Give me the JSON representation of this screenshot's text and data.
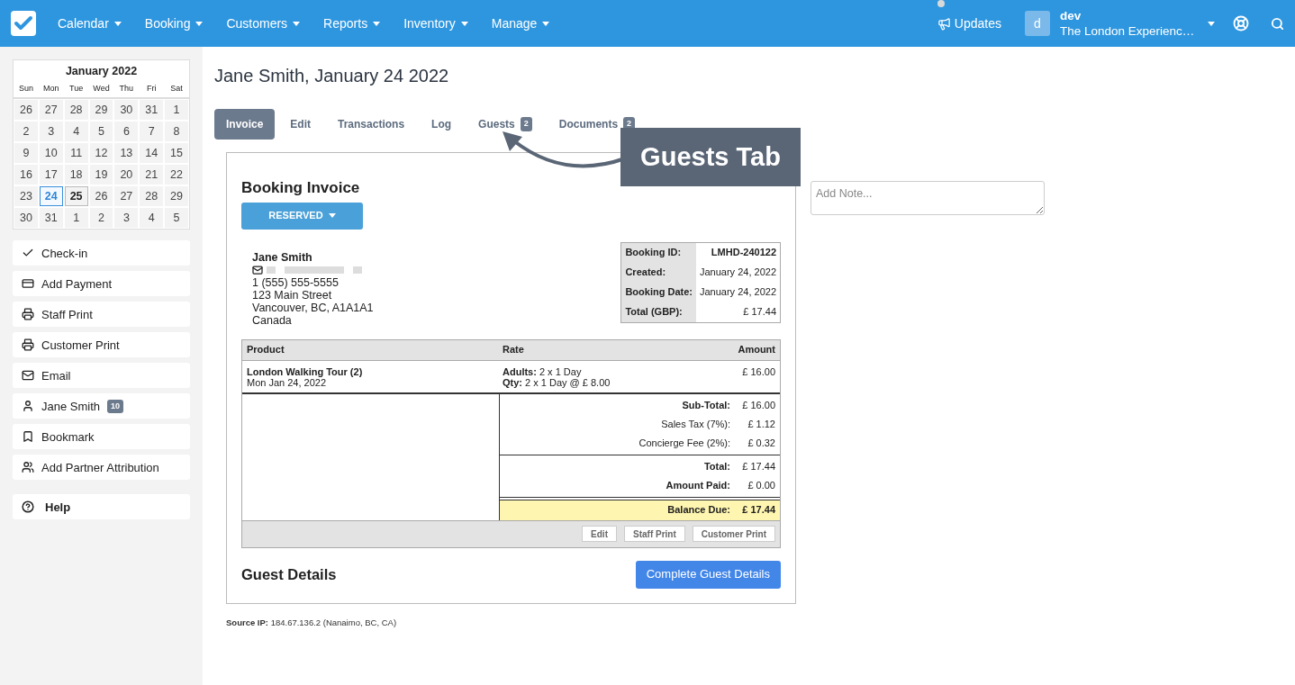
{
  "nav": {
    "menus": [
      {
        "label": "Calendar"
      },
      {
        "label": "Booking"
      },
      {
        "label": "Customers"
      },
      {
        "label": "Reports"
      },
      {
        "label": "Inventory"
      },
      {
        "label": "Manage"
      }
    ],
    "updates": {
      "label": "Updates",
      "unread": true
    },
    "user": {
      "initial": "d",
      "name": "dev",
      "company": "The London Experienc…"
    }
  },
  "calendar": {
    "title": "January 2022",
    "weekdays": [
      "Sun",
      "Mon",
      "Tue",
      "Wed",
      "Thu",
      "Fri",
      "Sat"
    ],
    "weeks": [
      [
        {
          "label": "26",
          "selected": false,
          "today": false
        },
        {
          "label": "27",
          "selected": false,
          "today": false
        },
        {
          "label": "28",
          "selected": false,
          "today": false
        },
        {
          "label": "29",
          "selected": false,
          "today": false
        },
        {
          "label": "30",
          "selected": false,
          "today": false
        },
        {
          "label": "31",
          "selected": false,
          "today": false
        },
        {
          "label": "1",
          "selected": false,
          "today": false
        }
      ],
      [
        {
          "label": "2",
          "selected": false,
          "today": false
        },
        {
          "label": "3",
          "selected": false,
          "today": false
        },
        {
          "label": "4",
          "selected": false,
          "today": false
        },
        {
          "label": "5",
          "selected": false,
          "today": false
        },
        {
          "label": "6",
          "selected": false,
          "today": false
        },
        {
          "label": "7",
          "selected": false,
          "today": false
        },
        {
          "label": "8",
          "selected": false,
          "today": false
        }
      ],
      [
        {
          "label": "9",
          "selected": false,
          "today": false
        },
        {
          "label": "10",
          "selected": false,
          "today": false
        },
        {
          "label": "11",
          "selected": false,
          "today": false
        },
        {
          "label": "12",
          "selected": false,
          "today": false
        },
        {
          "label": "13",
          "selected": false,
          "today": false
        },
        {
          "label": "14",
          "selected": false,
          "today": false
        },
        {
          "label": "15",
          "selected": false,
          "today": false
        }
      ],
      [
        {
          "label": "16",
          "selected": false,
          "today": false
        },
        {
          "label": "17",
          "selected": false,
          "today": false
        },
        {
          "label": "18",
          "selected": false,
          "today": false
        },
        {
          "label": "19",
          "selected": false,
          "today": false
        },
        {
          "label": "20",
          "selected": false,
          "today": false
        },
        {
          "label": "21",
          "selected": false,
          "today": false
        },
        {
          "label": "22",
          "selected": false,
          "today": false
        }
      ],
      [
        {
          "label": "23",
          "selected": false,
          "today": false
        },
        {
          "label": "24",
          "selected": true,
          "today": false
        },
        {
          "label": "25",
          "selected": false,
          "today": true
        },
        {
          "label": "26",
          "selected": false,
          "today": false
        },
        {
          "label": "27",
          "selected": false,
          "today": false
        },
        {
          "label": "28",
          "selected": false,
          "today": false
        },
        {
          "label": "29",
          "selected": false,
          "today": false
        }
      ],
      [
        {
          "label": "30",
          "selected": false,
          "today": false
        },
        {
          "label": "31",
          "selected": false,
          "today": false
        },
        {
          "label": "1",
          "selected": false,
          "today": false
        },
        {
          "label": "2",
          "selected": false,
          "today": false
        },
        {
          "label": "3",
          "selected": false,
          "today": false
        },
        {
          "label": "4",
          "selected": false,
          "today": false
        },
        {
          "label": "5",
          "selected": false,
          "today": false
        }
      ]
    ]
  },
  "actions": [
    {
      "label": "Check-in",
      "kind": "checkin"
    },
    {
      "label": "Add Payment",
      "kind": "payment"
    },
    {
      "label": "Staff Print",
      "kind": "print"
    },
    {
      "label": "Customer Print",
      "kind": "print"
    },
    {
      "label": "Email",
      "kind": "email"
    },
    {
      "label": "Jane Smith",
      "kind": "customer",
      "badge": "10"
    },
    {
      "label": "Bookmark",
      "kind": "bookmark"
    },
    {
      "label": "Add Partner Attribution",
      "kind": "partner"
    }
  ],
  "help": {
    "label": "Help"
  },
  "page_title": "Jane Smith, January 24 2022",
  "tabs": [
    {
      "label": "Invoice",
      "selected": true
    },
    {
      "label": "Edit",
      "selected": false
    },
    {
      "label": "Transactions",
      "selected": false
    },
    {
      "label": "Log",
      "selected": false
    },
    {
      "label": "Guests",
      "selected": false,
      "badge": "2"
    },
    {
      "label": "Documents",
      "selected": false,
      "badge": "2"
    }
  ],
  "callout": "Guests Tab",
  "note": {
    "placeholder": "Add Note..."
  },
  "invoice": {
    "title": "Booking Invoice",
    "status": "RESERVED",
    "customer": {
      "name": "Jane Smith",
      "lines": [
        "1 (555) 555-5555",
        "123 Main Street",
        "Vancouver, BC, A1A1A1",
        "Canada"
      ]
    },
    "details": [
      {
        "label": "Booking ID:",
        "value": "LMHD-240122",
        "strong": true
      },
      {
        "label": "Created:",
        "value": "January 24, 2022",
        "strong": false
      },
      {
        "label": "Booking Date:",
        "value": "January 24, 2022",
        "strong": false
      },
      {
        "label": "Total (GBP):",
        "value": "£ 17.44",
        "strong": false
      }
    ],
    "columns": [
      "Product",
      "Rate",
      "Amount"
    ],
    "items": [
      {
        "product": "London Walking Tour (2)",
        "date": "Mon Jan 24, 2022",
        "rates": [
          "**Adults:** 2 x 1 Day",
          "**Qty:** 2 x 1 Day @ £ 8.00"
        ],
        "amount": "£ 16.00"
      }
    ],
    "total_groups": [
      [
        {
          "label": "Sub-Total:",
          "value": "£ 16.00",
          "strong": true
        },
        {
          "label": "Sales Tax (7%):",
          "value": "£ 1.12",
          "strong": false
        },
        {
          "label": "Concierge Fee (2%):",
          "value": "£ 0.32",
          "strong": false
        }
      ],
      [
        {
          "label": "Total:",
          "value": "£ 17.44",
          "strong": true
        },
        {
          "label": "Amount Paid:",
          "value": "£ 0.00",
          "strong": true
        }
      ]
    ],
    "balance": {
      "label": "Balance Due:",
      "value": "£ 17.44"
    },
    "footer_buttons": [
      "Edit",
      "Staff Print",
      "Customer Print"
    ],
    "guest_title": "Guest Details",
    "guest_button": "Complete Guest Details"
  },
  "source_ip": "**Source IP:** 184.67.136.2 (Nanaimo, BC, CA)"
}
